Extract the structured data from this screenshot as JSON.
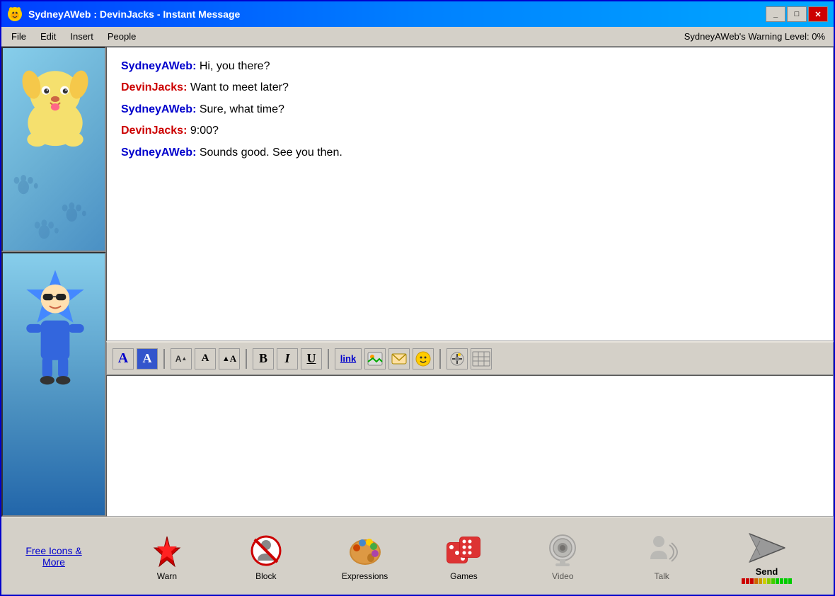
{
  "window": {
    "title": "SydneyAWeb : DevinJacks - Instant Message",
    "minimize_label": "_",
    "maximize_label": "□",
    "close_label": "✕"
  },
  "menubar": {
    "items": [
      "File",
      "Edit",
      "Insert",
      "People"
    ],
    "warning_level": "SydneyAWeb's Warning Level: 0%"
  },
  "chat": {
    "messages": [
      {
        "user": "SydneyAWeb",
        "user_type": "sydney",
        "text": " Hi, you there?"
      },
      {
        "user": "DevinJacks:",
        "user_type": "devin",
        "text": "  Want to meet later?"
      },
      {
        "user": "SydneyAWeb:",
        "user_type": "sydney",
        "text": " Sure, what time?"
      },
      {
        "user": "DevinJacks:",
        "user_type": "devin",
        "text": "  9:00?"
      },
      {
        "user": "SydneyAWeb:",
        "user_type": "sydney",
        "text": " Sounds good. See you then."
      }
    ]
  },
  "toolbar": {
    "buttons": [
      {
        "id": "font-a",
        "label": "A",
        "style": "blue"
      },
      {
        "id": "font-a-bg",
        "label": "A",
        "style": "bg"
      },
      {
        "id": "font-smaller",
        "label": "A↓",
        "style": "small"
      },
      {
        "id": "font-normal",
        "label": "A",
        "style": "normal"
      },
      {
        "id": "font-larger",
        "label": "ÂA",
        "style": "large"
      },
      {
        "id": "bold",
        "label": "B",
        "style": "bold"
      },
      {
        "id": "italic",
        "label": "I",
        "style": "italic"
      },
      {
        "id": "underline",
        "label": "U",
        "style": "underline"
      },
      {
        "id": "link",
        "label": "link",
        "style": "link"
      },
      {
        "id": "image",
        "label": "🖼",
        "style": "icon"
      },
      {
        "id": "email",
        "label": "✉",
        "style": "icon"
      },
      {
        "id": "smiley",
        "label": "☺",
        "style": "icon"
      },
      {
        "id": "plugin",
        "label": "⚡",
        "style": "icon"
      },
      {
        "id": "table",
        "label": "▦",
        "style": "icon"
      }
    ]
  },
  "bottom": {
    "free_icons_link": "Free Icons &\nMore",
    "actions": [
      {
        "id": "warn",
        "label": "Warn"
      },
      {
        "id": "block",
        "label": "Block"
      },
      {
        "id": "expressions",
        "label": "Expressions"
      },
      {
        "id": "games",
        "label": "Games"
      },
      {
        "id": "video",
        "label": "Video"
      },
      {
        "id": "talk",
        "label": "Talk"
      },
      {
        "id": "send",
        "label": "Send"
      }
    ]
  }
}
